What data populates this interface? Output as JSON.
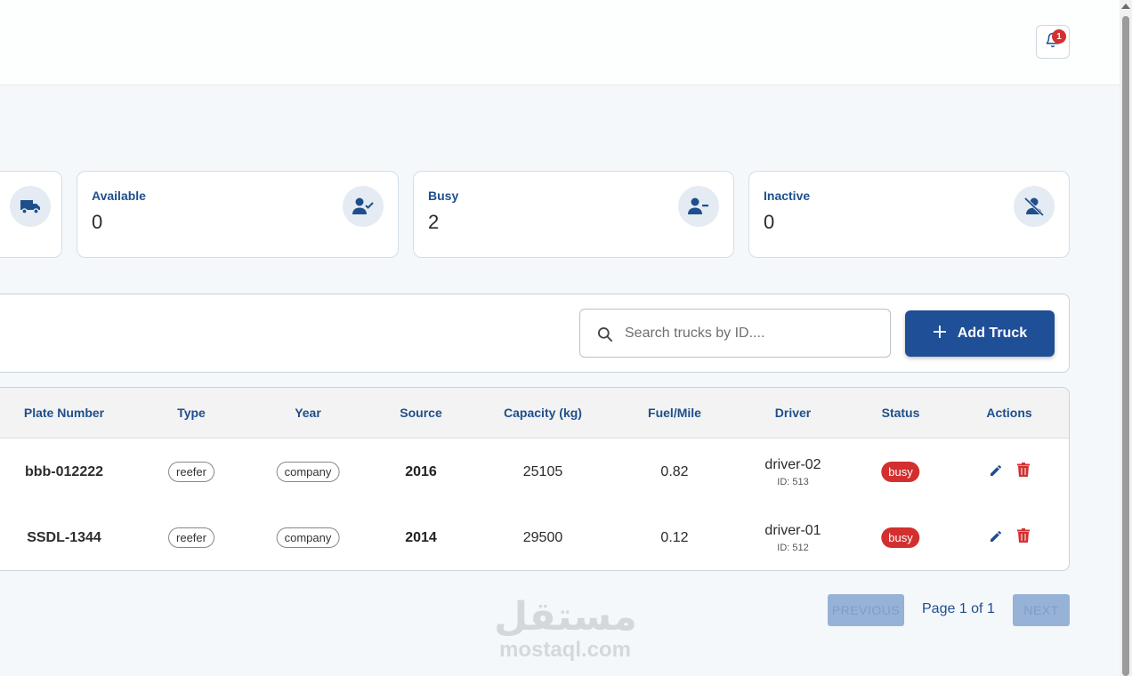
{
  "header": {
    "notifications_count": "1"
  },
  "stats": [
    {
      "label": "",
      "value": "",
      "icon": "truck-icon"
    },
    {
      "label": "Available",
      "value": "0",
      "icon": "user-check-icon"
    },
    {
      "label": "Busy",
      "value": "2",
      "icon": "user-minus-icon"
    },
    {
      "label": "Inactive",
      "value": "0",
      "icon": "user-off-icon"
    }
  ],
  "toolbar": {
    "search_placeholder": "Search trucks by ID....",
    "add_label": "Add Truck"
  },
  "table": {
    "columns": [
      "Plate Number",
      "Type",
      "Year",
      "Source",
      "Capacity (kg)",
      "Fuel/Mile",
      "Driver",
      "Status",
      "Actions"
    ],
    "rows": [
      {
        "plate": "bbb-012222",
        "type": "reefer",
        "source_chip": "company",
        "year": "2016",
        "capacity": "25105",
        "fuel": "0.82",
        "driver": "driver-02",
        "driver_id": "ID: 513",
        "status": "busy"
      },
      {
        "plate": "SSDL-1344",
        "type": "reefer",
        "source_chip": "company",
        "year": "2014",
        "capacity": "29500",
        "fuel": "0.12",
        "driver": "driver-01",
        "driver_id": "ID: 512",
        "status": "busy"
      }
    ]
  },
  "pagination": {
    "previous_label": "PREVIOUS",
    "page_text": "Page 1 of 1",
    "next_label": "NEXT"
  },
  "watermark": {
    "arabic": "مستقل",
    "latin": "mostaql.com"
  },
  "colors": {
    "primary": "#1f4f97",
    "label": "#1e4f8c",
    "danger": "#d32f2f",
    "icon_bg": "#e4ebf2"
  }
}
